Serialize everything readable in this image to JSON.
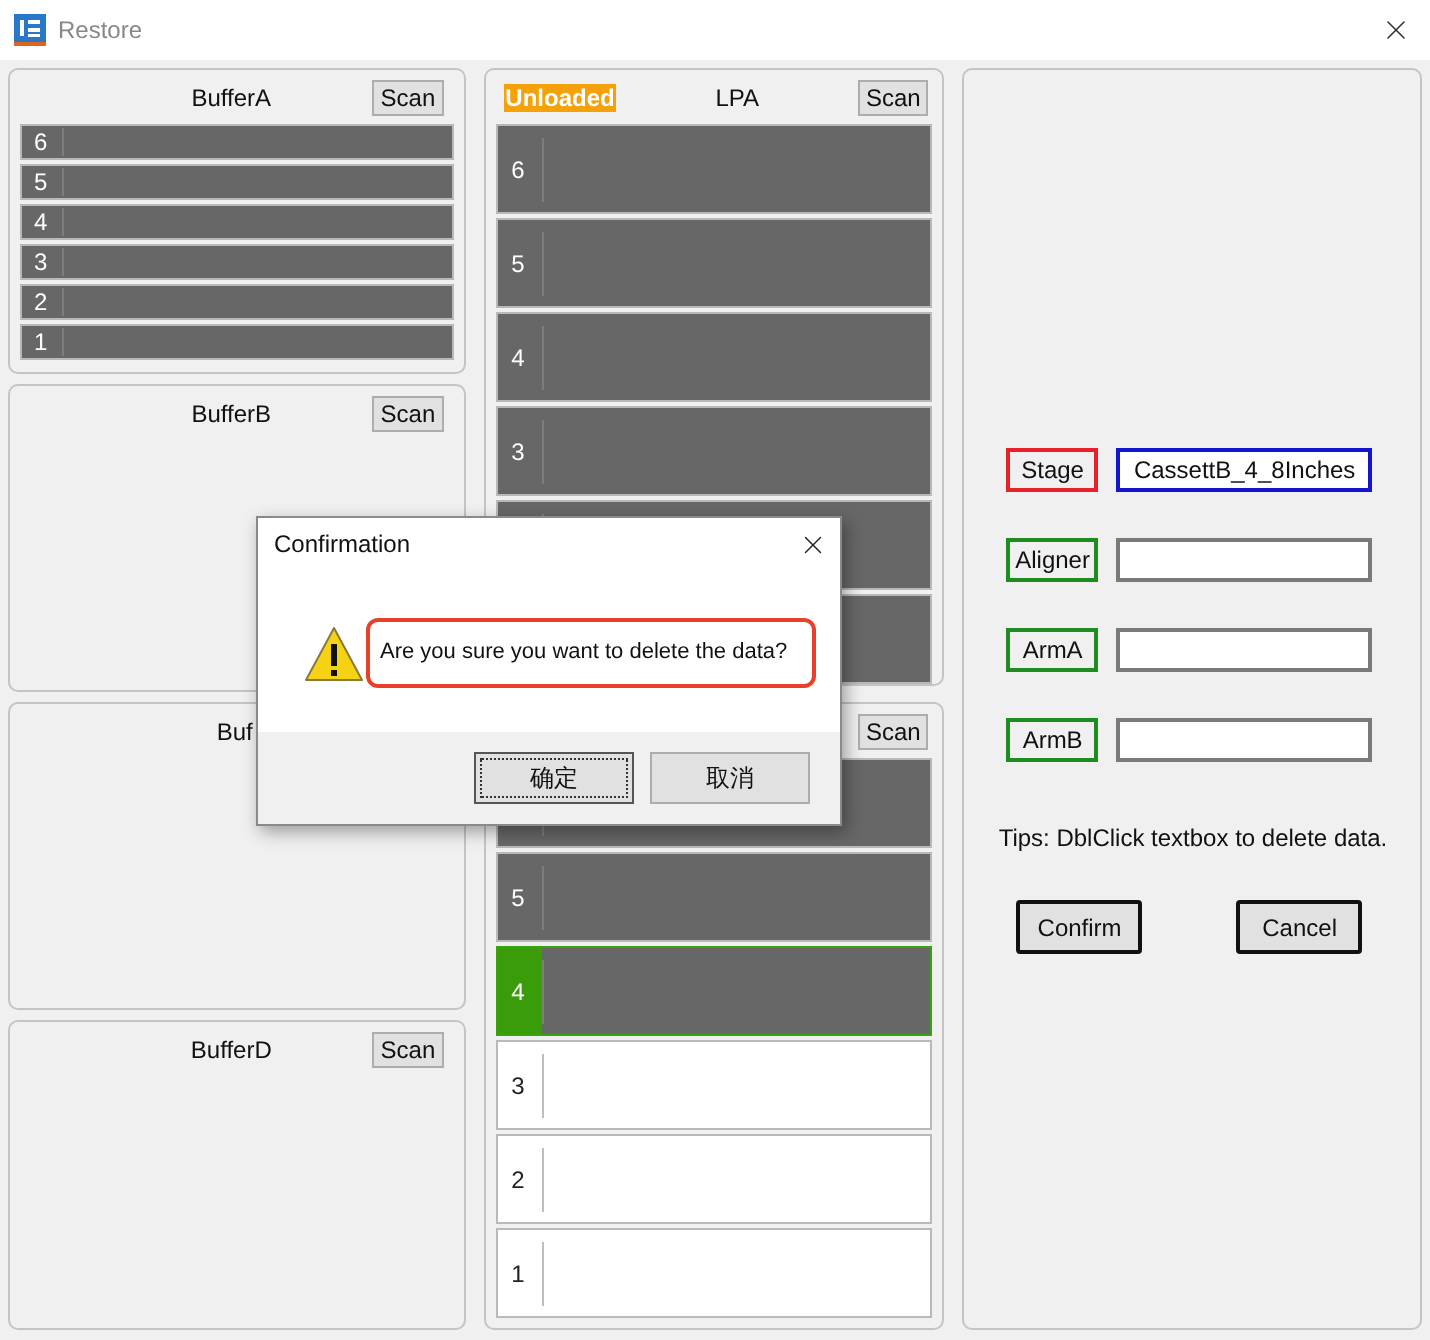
{
  "window": {
    "title": "Restore"
  },
  "buffers": [
    {
      "title": "BufferA",
      "scan": "Scan",
      "slots": [
        {
          "label": "6"
        },
        {
          "label": "5"
        },
        {
          "label": "4"
        },
        {
          "label": "3"
        },
        {
          "label": "2"
        },
        {
          "label": "1"
        }
      ]
    },
    {
      "title": "BufferB",
      "scan": "Scan"
    },
    {
      "title": "Buf"
    },
    {
      "title": "BufferD",
      "scan": "Scan"
    }
  ],
  "lpa_panels": [
    {
      "status": "Unloaded",
      "title": "LPA",
      "scan": "Scan",
      "slots": [
        {
          "label": "6",
          "filled": true,
          "selected": false
        },
        {
          "label": "5",
          "filled": true,
          "selected": false
        },
        {
          "label": "4",
          "filled": true,
          "selected": false
        },
        {
          "label": "3",
          "filled": true,
          "selected": false
        },
        {
          "filled": true,
          "selected": false
        },
        {
          "filled": true,
          "selected": false
        }
      ]
    },
    {
      "scan": "Scan",
      "slots": [
        {
          "filled": true,
          "selected": false
        },
        {
          "label": "5",
          "filled": true,
          "selected": false
        },
        {
          "label": "4",
          "filled": true,
          "selected": true
        },
        {
          "label": "3",
          "filled": false,
          "selected": false
        },
        {
          "label": "2",
          "filled": false,
          "selected": false
        },
        {
          "label": "1",
          "filled": false,
          "selected": false
        }
      ]
    }
  ],
  "assignments": [
    {
      "label": "Stage",
      "color": "#e8202a",
      "value": "CassettB_4_8Inches",
      "highlighted": true
    },
    {
      "label": "Aligner",
      "color": "#1e8c1e",
      "highlighted": false
    },
    {
      "label": "ArmA",
      "color": "#1e8c1e",
      "highlighted": false
    },
    {
      "label": "ArmB",
      "color": "#1e8c1e",
      "highlighted": false
    }
  ],
  "tips": "Tips: DblClick textbox to delete data.",
  "buttons": [
    "Confirm",
    "Cancel"
  ],
  "dialog": {
    "title": "Confirmation",
    "message": "Are you sure you want to delete the data?",
    "message_highlighted": true,
    "buttons": [
      {
        "label": "确定",
        "focused": true
      },
      {
        "label": "取消",
        "focused": false
      }
    ]
  }
}
